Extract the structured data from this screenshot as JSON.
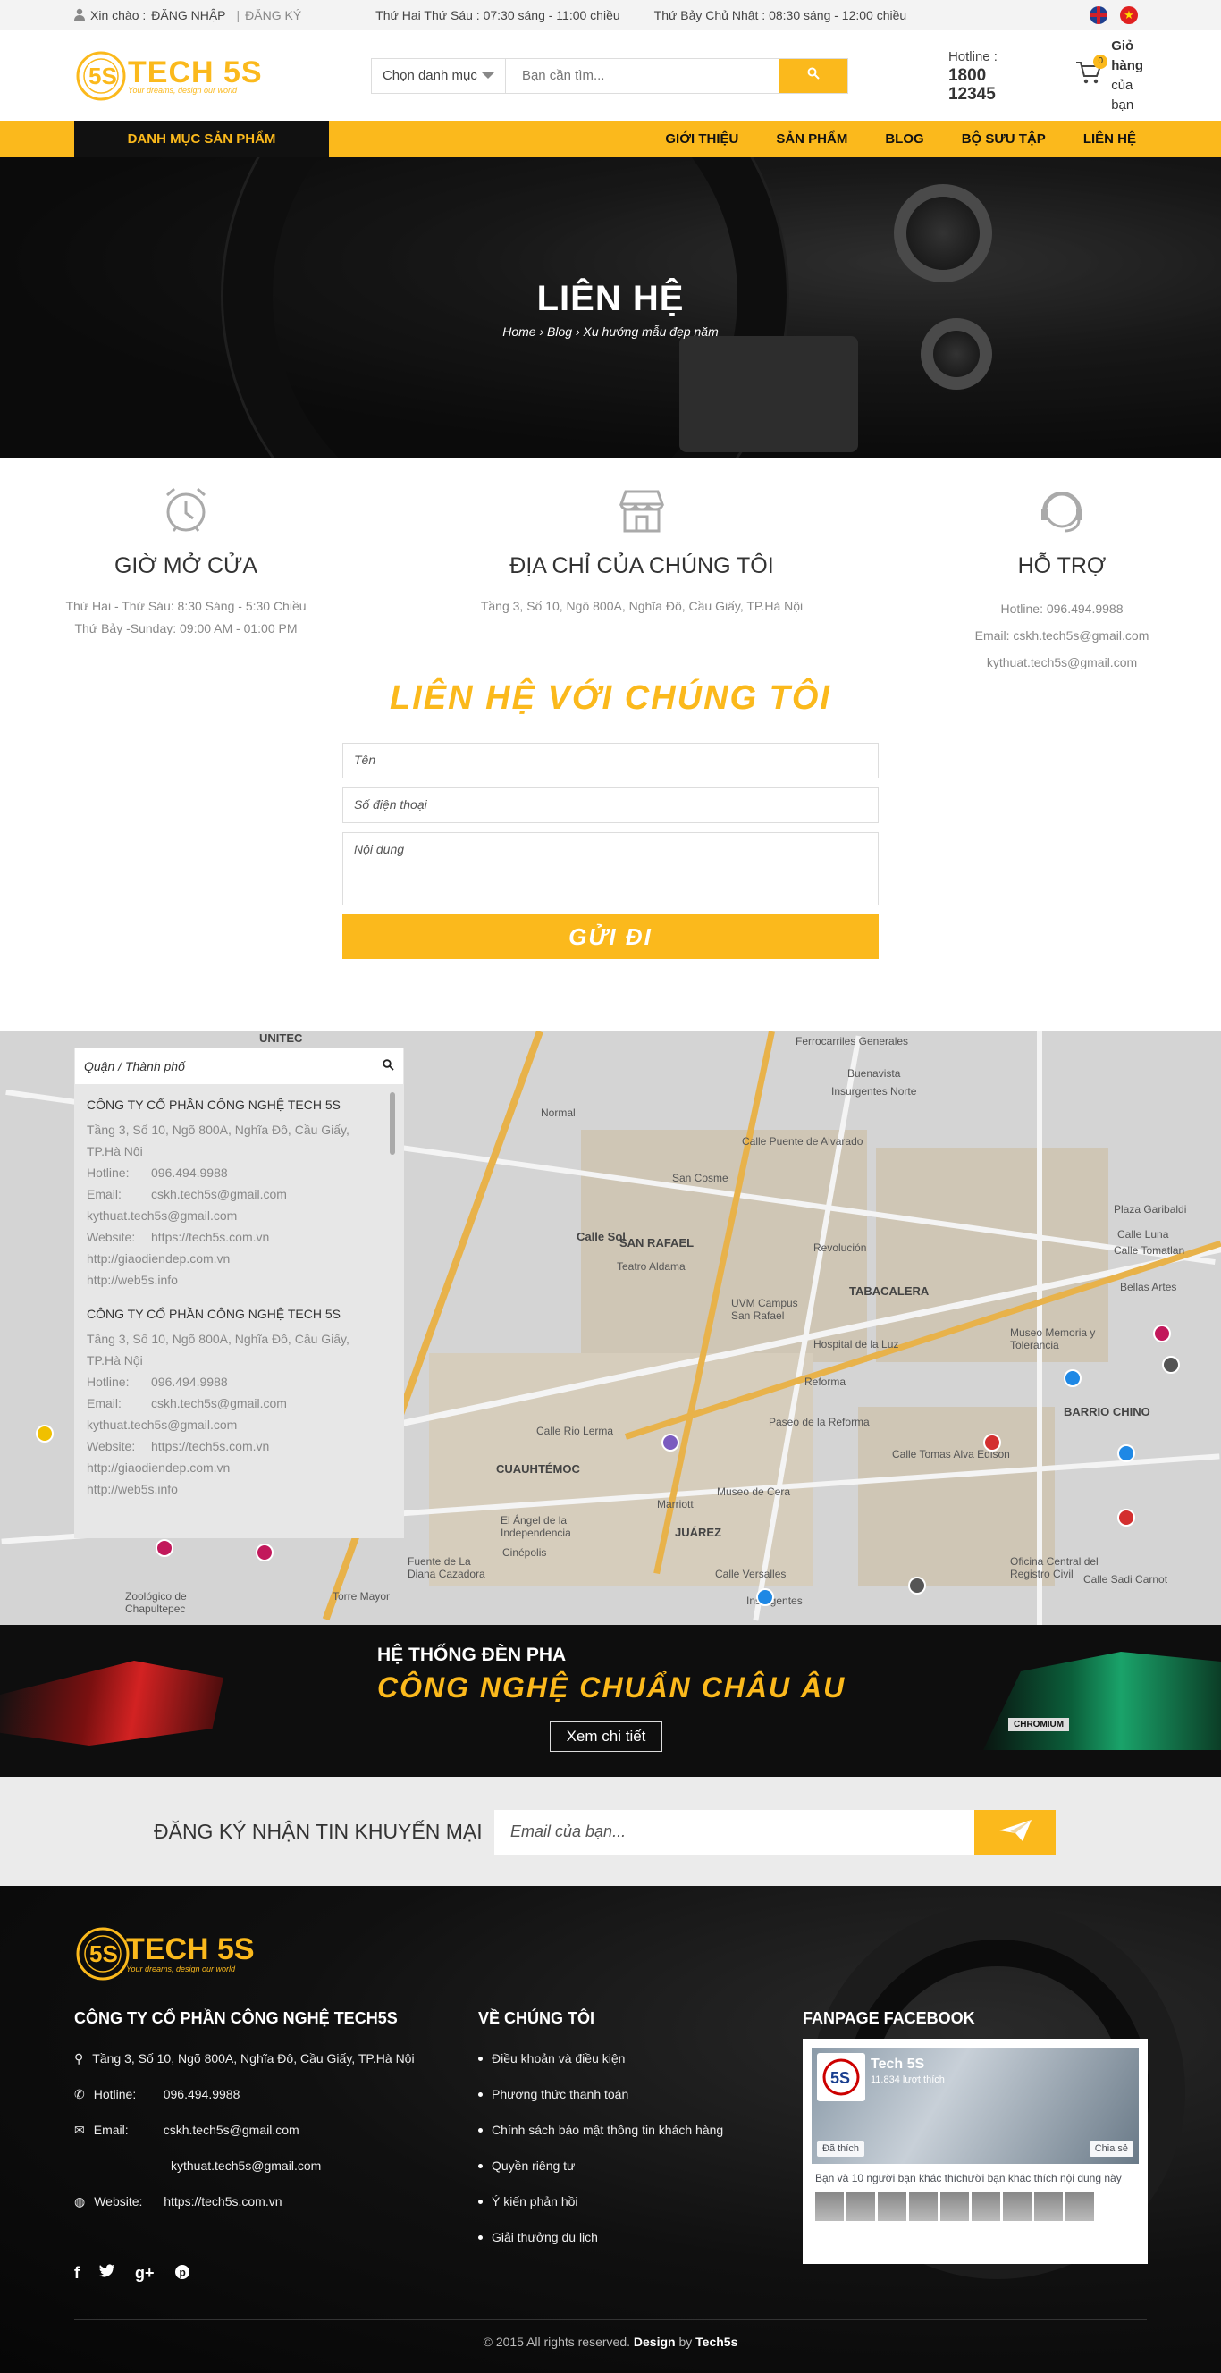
{
  "topbar": {
    "greeting": "Xin chào :",
    "login": "ĐĂNG NHẬP",
    "register": "ĐĂNG KÝ",
    "hours_weekday": "Thứ Hai Thứ Sáu : 07:30 sáng - 11:00 chiều",
    "hours_weekend": "Thứ Bảy Chủ Nhật : 08:30 sáng - 12:00 chiều"
  },
  "header": {
    "logo_text": "TECH 5S",
    "logo_tag": "Your dreams, design our world",
    "category_select": "Chọn danh mục",
    "search_placeholder": "Bạn cần tìm...",
    "hotline_label": "Hotline :",
    "hotline_number": "1800 12345",
    "cart_count": "0",
    "cart_line1": "Giỏ hàng",
    "cart_line2": "của bạn"
  },
  "nav": {
    "categories_button": "DANH MỤC SẢN PHẨM",
    "items": [
      "GIỚI THIỆU",
      "SẢN PHẨM",
      "BLOG",
      "BỘ SƯU TẬP",
      "LIÊN HỆ"
    ]
  },
  "hero": {
    "title": "LIÊN HỆ",
    "breadcrumb": [
      "Home",
      "Blog",
      "Xu hướng mẫu đẹp năm"
    ]
  },
  "info": {
    "hours": {
      "title": "GIỜ MỞ CỬA",
      "line1": "Thứ Hai - Thứ Sáu: 8:30 Sáng - 5:30 Chiều",
      "line2": "Thứ Bảy -Sunday: 09:00 AM - 01:00 PM"
    },
    "address": {
      "title": "ĐỊA CHỈ CỦA CHÚNG TÔI",
      "line1": "Tầng 3, Số 10, Ngõ 800A, Nghĩa Đô, Cầu Giấy, TP.Hà Nội"
    },
    "support": {
      "title": "HỖ TRỢ",
      "line1": "Hotline: 096.494.9988",
      "line2": "Email: cskh.tech5s@gmail.com",
      "line3": "kythuat.tech5s@gmail.com"
    }
  },
  "contact": {
    "title": "LIÊN HỆ VỚI CHÚNG TÔI",
    "name_placeholder": "Tên",
    "phone_placeholder": "Số điện thoại",
    "content_placeholder": "Nội dung",
    "submit": "GỬI ĐI"
  },
  "map_panel": {
    "search_placeholder": "Quận / Thành phố",
    "stores": [
      {
        "name": "CÔNG TY CỔ PHẦN CÔNG NGHỆ TECH 5S",
        "address": "Tầng 3, Số 10, Ngõ 800A, Nghĩa Đô, Cầu Giấy, TP.Hà Nội",
        "hotline_label": "Hotline:",
        "hotline": "096.494.9988",
        "email_label": "Email:",
        "email": "cskh.tech5s@gmail.com",
        "email2": "kythuat.tech5s@gmail.com",
        "website_label": "Website:",
        "website": "https://tech5s.com.vn",
        "site2": "http://giaodiendep.com.vn",
        "site3": "http://web5s.info"
      },
      {
        "name": "CÔNG TY CỔ PHẦN CÔNG NGHỆ TECH 5S",
        "address": "Tầng 3, Số 10, Ngõ 800A, Nghĩa Đô, Cầu Giấy, TP.Hà Nội",
        "hotline_label": "Hotline:",
        "hotline": "096.494.9988",
        "email_label": "Email:",
        "email": "cskh.tech5s@gmail.com",
        "email2": "kythuat.tech5s@gmail.com",
        "website_label": "Website:",
        "website": "https://tech5s.com.vn",
        "site2": "http://giaodiendep.com.vn",
        "site3": "http://web5s.info"
      }
    ]
  },
  "map_labels": [
    "UNITEC",
    "SAN RAFAEL",
    "Teatro Aldama",
    "UVM Campus San Rafael",
    "TABACALERA",
    "Hospital de la Luz",
    "Museo Memoria y Tolerancia",
    "BARRIO CHINO",
    "CUAUHTÉMOC",
    "Museo de Cera",
    "JUÁREZ",
    "Marriott",
    "El Ángel de la Independencia",
    "Cinépolis",
    "Zoológico de Chapultepec",
    "Torre Mayor",
    "Fuente de La Diana Cazadora",
    "Plaza Garibaldi",
    "Oficina Central del Registro Civil",
    "Calle Sadi Carnot",
    "Calle Rio Lerma",
    "Calle Versalles",
    "Calle Tomas Alva Edison",
    "Insurgentes Norte",
    "Insurgentes",
    "Revolución",
    "Reforma",
    "Paseo de la Reforma",
    "Bellas Artes",
    "San Cosme",
    "Normal",
    "Buenavista",
    "Ferrocarriles Generales",
    "Calle Puente de Alvarado",
    "Calle Tomatlan",
    "Calle Sol",
    "Calle Luna"
  ],
  "banner": {
    "line1": "HỆ THỐNG ĐÈN PHA",
    "line2": "CÔNG NGHỆ CHUẨN CHÂU ÂU",
    "button": "Xem chi tiết",
    "plate": "CHROMIUM"
  },
  "newsletter": {
    "label": "ĐĂNG KÝ NHẬN TIN KHUYẾN MẠI",
    "placeholder": "Email của bạn..."
  },
  "footer": {
    "logo_text": "TECH 5S",
    "logo_tag": "Your dreams, design our world",
    "company": "CÔNG TY CỔ PHẦN CÔNG NGHỆ TECH5S",
    "address": "Tầng 3, Số 10, Ngõ 800A, Nghĩa Đô, Cầu Giấy, TP.Hà Nội",
    "hotline_label": "Hotline:",
    "hotline": "096.494.9988",
    "email_label": "Email:",
    "email1": "cskh.tech5s@gmail.com",
    "email2": "kythuat.tech5s@gmail.com",
    "website_label": "Website:",
    "website": "https://tech5s.com.vn",
    "about_title": "VỀ CHÚNG TÔI",
    "about_links": [
      "Điều khoản và điều kiện",
      "Phương thức thanh toán",
      "Chính sách bảo mật thông tin khách hàng",
      "Quyền riêng tư",
      "Ý kiến phản hồi",
      "Giải thưởng du lịch"
    ],
    "fanpage_title": "FANPAGE FACEBOOK",
    "fb_name": "Tech 5S",
    "fb_likes": "11.834 lượt thích",
    "fb_liked": "Đã thích",
    "fb_share": "Chia sẻ",
    "fb_text": "Bạn và 10 người bạn khác thíchười bạn khác thích nội dung này",
    "copyright_pre": "© 2015 All rights reserved.",
    "copyright_design": "Design",
    "copyright_by": "by",
    "copyright_brand": "Tech5s"
  },
  "colors": {
    "accent": "#fbb91c",
    "dark": "#111111"
  }
}
